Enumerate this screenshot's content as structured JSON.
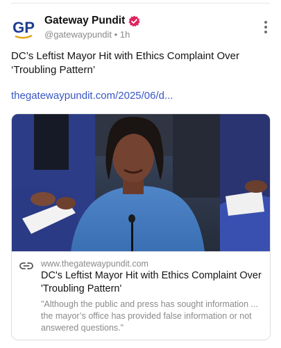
{
  "author": {
    "name": "Gateway Pundit",
    "handle": "@gatewaypundit",
    "separator": "•",
    "time": "1h",
    "avatar_text": "GP"
  },
  "post": {
    "text": "DC’s Leftist Mayor Hit with Ethics Complaint Over ‘Troubling Pattern’",
    "link_text": "thegatewaypundit.com/2025/06/d..."
  },
  "card": {
    "domain": "www.thegatewaypundit.com",
    "title": "DC's Leftist Mayor Hit with Ethics Complaint Over 'Troubling Pattern'",
    "description": "\"Although the public and press has sought information ... the mayor’s office has provided false information or not answered questions.\""
  },
  "icons": {
    "verified": "verified-badge-icon",
    "more": "more-vertical-icon",
    "link": "link-icon"
  },
  "colors": {
    "link": "#3957c4",
    "verified": "#e0245e",
    "avatar_blue": "#1f3c8f",
    "avatar_gold": "#e2a418",
    "muted_text": "#8a8a8a"
  }
}
